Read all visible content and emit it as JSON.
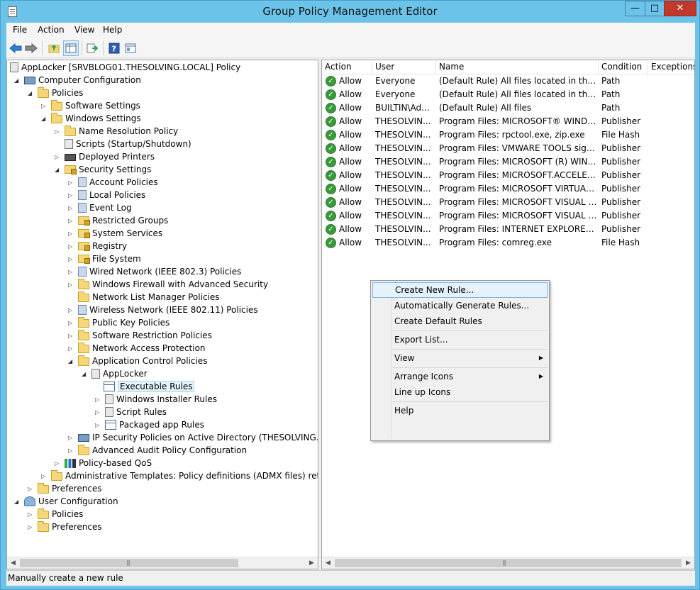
{
  "window": {
    "title": "Group Policy Management Editor",
    "minimize": "—",
    "maximize": "□",
    "close": "✕"
  },
  "menu": [
    "File",
    "Action",
    "View",
    "Help"
  ],
  "toolbar": {
    "icons": [
      "back-icon",
      "forward-icon",
      "up-folder-icon",
      "show-hide-tree-icon",
      "export-list-icon",
      "help-icon",
      "properties-icon"
    ]
  },
  "tree": {
    "root": "AppLocker [SRVBLOG01.THESOLVING.LOCAL] Policy",
    "computer_configuration": "Computer Configuration",
    "policies": "Policies",
    "software_settings": "Software Settings",
    "windows_settings": "Windows Settings",
    "name_resolution_policy": "Name Resolution Policy",
    "scripts": "Scripts (Startup/Shutdown)",
    "deployed_printers": "Deployed Printers",
    "security_settings": "Security Settings",
    "account_policies": "Account Policies",
    "local_policies": "Local Policies",
    "event_log": "Event Log",
    "restricted_groups": "Restricted Groups",
    "system_services": "System Services",
    "registry": "Registry",
    "file_system": "File System",
    "wired_network": "Wired Network (IEEE 802.3) Policies",
    "windows_firewall": "Windows Firewall with Advanced Security",
    "network_list_manager": "Network List Manager Policies",
    "wireless_network": "Wireless Network (IEEE 802.11) Policies",
    "public_key_policies": "Public Key Policies",
    "software_restriction": "Software Restriction Policies",
    "network_access_protection": "Network Access Protection",
    "application_control": "Application Control Policies",
    "applocker": "AppLocker",
    "executable_rules": "Executable Rules",
    "windows_installer_rules": "Windows Installer Rules",
    "script_rules": "Script Rules",
    "packaged_app_rules": "Packaged app Rules",
    "ip_security": "IP Security Policies on Active Directory (THESOLVING.LOCAL",
    "advanced_audit": "Advanced Audit Policy Configuration",
    "policy_based_qos": "Policy-based QoS",
    "admin_templates": "Administrative Templates: Policy definitions (ADMX files) retrieved f",
    "preferences": "Preferences",
    "user_configuration": "User Configuration",
    "user_policies": "Policies",
    "user_preferences": "Preferences"
  },
  "list": {
    "columns": [
      "Action",
      "User",
      "Name",
      "Condition",
      "Exceptions"
    ],
    "rows": [
      {
        "action": "Allow",
        "user": "Everyone",
        "name": "(Default Rule) All files located in the Pro...",
        "condition": "Path"
      },
      {
        "action": "Allow",
        "user": "Everyone",
        "name": "(Default Rule) All files located in the Wi...",
        "condition": "Path"
      },
      {
        "action": "Allow",
        "user": "BUILTIN\\Ad...",
        "name": "(Default Rule) All files",
        "condition": "Path"
      },
      {
        "action": "Allow",
        "user": "THESOLVIN...",
        "name": "Program Files: MICROSOFT® WINDOW...",
        "condition": "Publisher"
      },
      {
        "action": "Allow",
        "user": "THESOLVIN...",
        "name": "Program Files: rpctool.exe, zip.exe",
        "condition": "File Hash"
      },
      {
        "action": "Allow",
        "user": "THESOLVIN...",
        "name": "Program Files: VMWARE TOOLS signed ...",
        "condition": "Publisher"
      },
      {
        "action": "Allow",
        "user": "THESOLVIN...",
        "name": "Program Files: MICROSOFT (R) WINDO...",
        "condition": "Publisher"
      },
      {
        "action": "Allow",
        "user": "THESOLVIN...",
        "name": "Program Files: MICROSOFT.ACCELERA...",
        "condition": "Publisher"
      },
      {
        "action": "Allow",
        "user": "THESOLVIN...",
        "name": "Program Files: MICROSOFT VIRTUAL M...",
        "condition": "Publisher"
      },
      {
        "action": "Allow",
        "user": "THESOLVIN...",
        "name": "Program Files: MICROSOFT VISUAL C+...",
        "condition": "Publisher"
      },
      {
        "action": "Allow",
        "user": "THESOLVIN...",
        "name": "Program Files: MICROSOFT VISUAL C+...",
        "condition": "Publisher"
      },
      {
        "action": "Allow",
        "user": "THESOLVIN...",
        "name": "Program Files: INTERNET EXPLORER sig...",
        "condition": "Publisher"
      },
      {
        "action": "Allow",
        "user": "THESOLVIN...",
        "name": "Program Files: comreg.exe",
        "condition": "File Hash"
      }
    ]
  },
  "context_menu": {
    "create_new_rule": "Create New Rule...",
    "auto_generate": "Automatically Generate Rules...",
    "create_default": "Create Default Rules",
    "export_list": "Export List...",
    "view": "View",
    "arrange_icons": "Arrange Icons",
    "line_up_icons": "Line up Icons",
    "help": "Help"
  },
  "status": {
    "text": "Manually create a new rule"
  },
  "colors": {
    "title_bar": "#6cc3ea",
    "close_button": "#c0392b",
    "allow_check": "#3a9a3a",
    "menu_highlight": "#e5f1fb"
  }
}
